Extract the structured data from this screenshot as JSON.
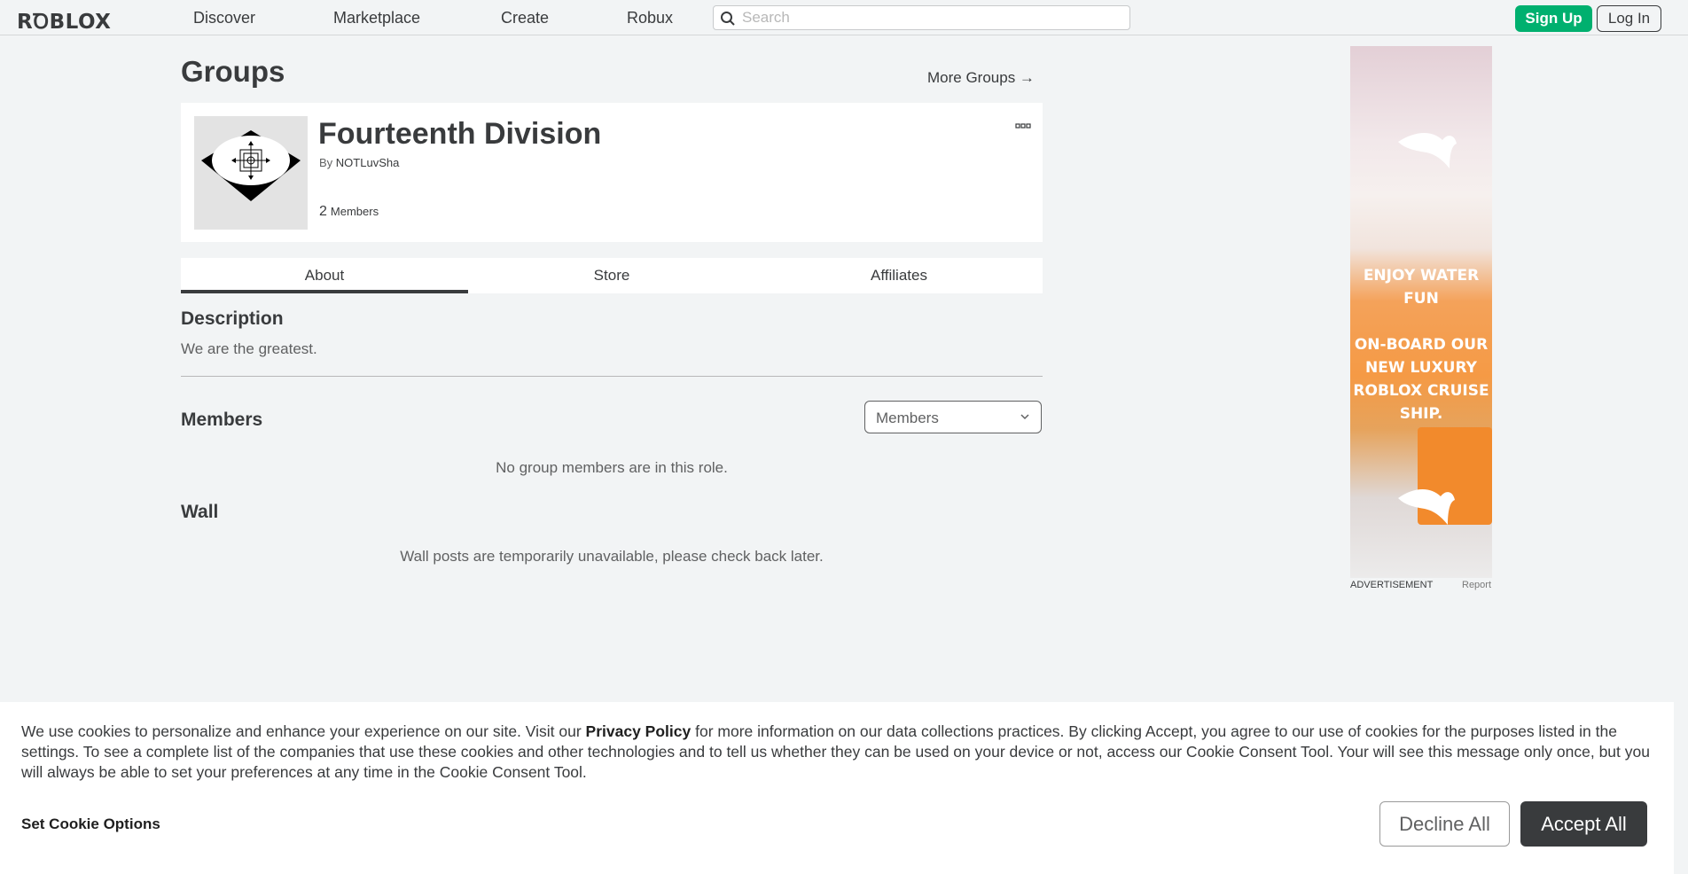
{
  "header": {
    "logo": "RꝹBLOX",
    "nav": [
      "Discover",
      "Marketplace",
      "Create",
      "Robux"
    ],
    "search_placeholder": "Search",
    "signup_label": "Sign Up",
    "login_label": "Log In"
  },
  "page": {
    "title": "Groups",
    "more_groups": "More Groups →"
  },
  "group": {
    "name": "Fourteenth Division",
    "by_prefix": "By",
    "owner": "NOTLuvSha",
    "member_count": "2",
    "members_label": "Members",
    "menu_icon": "more-dots-icon"
  },
  "tabs": [
    "About",
    "Store",
    "Affiliates"
  ],
  "active_tab": "About",
  "about": {
    "description_title": "Description",
    "description_text": "We are the greatest.",
    "members_title": "Members",
    "role_selected": "Members",
    "no_members_msg": "No group members are in this role.",
    "wall_title": "Wall",
    "wall_msg": "Wall posts are temporarily unavailable, please check back later."
  },
  "ad": {
    "line1": "ENJOY WATER",
    "line2": "FUN",
    "line3": "ON-BOARD OUR",
    "line4": "NEW LUXURY",
    "line5": "ROBLOX CRUISE",
    "line6": "SHIP.",
    "label": "ADVERTISEMENT",
    "report": "Report"
  },
  "cookie": {
    "text_before": "We use cookies to personalize and enhance your experience on our site. Visit our ",
    "privacy_link": "Privacy Policy",
    "text_after": " for more information on our data collections practices. By clicking Accept, you agree to our use of cookies for the purposes listed in the settings. To see a complete list of the companies that use these cookies and other technologies and to tell us whether they can be used on your device or not, access our Cookie Consent Tool. Your will see this message only once, but you will always be able to set your preferences at any time in the Cookie Consent Tool.",
    "set_options": "Set Cookie Options",
    "decline": "Decline All",
    "accept": "Accept All"
  },
  "colors": {
    "accent_green": "#00b06f",
    "text_dark": "#393b3d",
    "background": "#f2f4f5"
  }
}
